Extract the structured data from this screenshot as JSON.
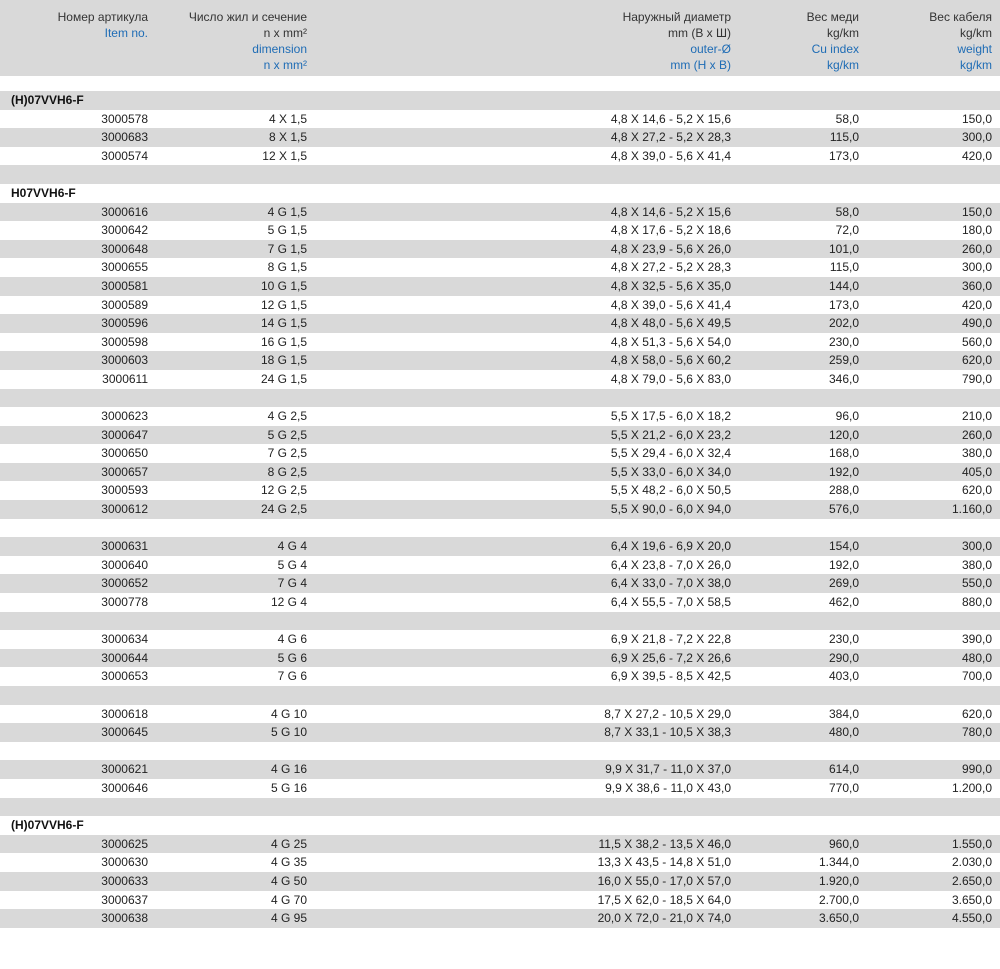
{
  "header": {
    "item": [
      "Номер артикула",
      "Item no."
    ],
    "dimension": [
      "Число жил и сечение",
      "n x mm²",
      "dimension",
      "n x mm²"
    ],
    "outer": [
      "Наружный диаметр",
      "mm (В x Ш)",
      "outer-Ø",
      "mm (H x B)"
    ],
    "cu": [
      "Вес меди",
      "kg/km",
      "Cu index",
      "kg/km"
    ],
    "weight": [
      "Вес кабеля",
      "kg/km",
      "weight",
      "kg/km"
    ]
  },
  "rows": [
    {
      "t": "title",
      "label": "(H)07VVH6-F"
    },
    {
      "t": "data",
      "v": [
        "3000578",
        "4 X 1,5",
        "4,8 X 14,6 - 5,2 X 15,6",
        "58,0",
        "150,0"
      ]
    },
    {
      "t": "data",
      "v": [
        "3000683",
        "8 X 1,5",
        "4,8 X 27,2 - 5,2 X 28,3",
        "115,0",
        "300,0"
      ]
    },
    {
      "t": "data",
      "v": [
        "3000574",
        "12 X 1,5",
        "4,8 X 39,0 - 5,6 X 41,4",
        "173,0",
        "420,0"
      ]
    },
    {
      "t": "blank"
    },
    {
      "t": "title",
      "label": "H07VVH6-F"
    },
    {
      "t": "data",
      "v": [
        "3000616",
        "4 G 1,5",
        "4,8 X 14,6 - 5,2 X 15,6",
        "58,0",
        "150,0"
      ]
    },
    {
      "t": "data",
      "v": [
        "3000642",
        "5 G 1,5",
        "4,8 X 17,6 - 5,2 X 18,6",
        "72,0",
        "180,0"
      ]
    },
    {
      "t": "data",
      "v": [
        "3000648",
        "7 G 1,5",
        "4,8 X 23,9 - 5,6 X 26,0",
        "101,0",
        "260,0"
      ]
    },
    {
      "t": "data",
      "v": [
        "3000655",
        "8 G 1,5",
        "4,8 X 27,2 - 5,2 X 28,3",
        "115,0",
        "300,0"
      ]
    },
    {
      "t": "data",
      "v": [
        "3000581",
        "10 G 1,5",
        "4,8 X 32,5 - 5,6 X 35,0",
        "144,0",
        "360,0"
      ]
    },
    {
      "t": "data",
      "v": [
        "3000589",
        "12 G 1,5",
        "4,8 X 39,0 - 5,6 X 41,4",
        "173,0",
        "420,0"
      ]
    },
    {
      "t": "data",
      "v": [
        "3000596",
        "14 G 1,5",
        "4,8 X 48,0 - 5,6 X 49,5",
        "202,0",
        "490,0"
      ]
    },
    {
      "t": "data",
      "v": [
        "3000598",
        "16 G 1,5",
        "4,8 X 51,3 - 5,6 X 54,0",
        "230,0",
        "560,0"
      ]
    },
    {
      "t": "data",
      "v": [
        "3000603",
        "18 G 1,5",
        "4,8 X 58,0 - 5,6 X 60,2",
        "259,0",
        "620,0"
      ]
    },
    {
      "t": "data",
      "v": [
        "3000611",
        "24 G 1,5",
        "4,8 X 79,0 - 5,6 X 83,0",
        "346,0",
        "790,0"
      ]
    },
    {
      "t": "blank"
    },
    {
      "t": "data",
      "v": [
        "3000623",
        "4 G 2,5",
        "5,5 X 17,5 - 6,0 X 18,2",
        "96,0",
        "210,0"
      ]
    },
    {
      "t": "data",
      "v": [
        "3000647",
        "5 G 2,5",
        "5,5 X 21,2 - 6,0 X 23,2",
        "120,0",
        "260,0"
      ]
    },
    {
      "t": "data",
      "v": [
        "3000650",
        "7 G 2,5",
        "5,5 X 29,4 - 6,0 X 32,4",
        "168,0",
        "380,0"
      ]
    },
    {
      "t": "data",
      "v": [
        "3000657",
        "8 G 2,5",
        "5,5 X 33,0 - 6,0 X 34,0",
        "192,0",
        "405,0"
      ]
    },
    {
      "t": "data",
      "v": [
        "3000593",
        "12 G 2,5",
        "5,5 X 48,2 - 6,0 X 50,5",
        "288,0",
        "620,0"
      ]
    },
    {
      "t": "data",
      "v": [
        "3000612",
        "24 G 2,5",
        "5,5 X 90,0 - 6,0 X 94,0",
        "576,0",
        "1.160,0"
      ]
    },
    {
      "t": "blank"
    },
    {
      "t": "data",
      "v": [
        "3000631",
        "4 G 4",
        "6,4 X 19,6 - 6,9 X 20,0",
        "154,0",
        "300,0"
      ]
    },
    {
      "t": "data",
      "v": [
        "3000640",
        "5 G 4",
        "6,4 X 23,8 - 7,0 X 26,0",
        "192,0",
        "380,0"
      ]
    },
    {
      "t": "data",
      "v": [
        "3000652",
        "7 G 4",
        "6,4 X 33,0 - 7,0 X 38,0",
        "269,0",
        "550,0"
      ]
    },
    {
      "t": "data",
      "v": [
        "3000778",
        "12 G 4",
        "6,4 X 55,5 - 7,0 X 58,5",
        "462,0",
        "880,0"
      ]
    },
    {
      "t": "blank"
    },
    {
      "t": "data",
      "v": [
        "3000634",
        "4 G 6",
        "6,9 X 21,8 - 7,2 X 22,8",
        "230,0",
        "390,0"
      ]
    },
    {
      "t": "data",
      "v": [
        "3000644",
        "5 G 6",
        "6,9 X 25,6 - 7,2 X 26,6",
        "290,0",
        "480,0"
      ]
    },
    {
      "t": "data",
      "v": [
        "3000653",
        "7 G 6",
        "6,9 X 39,5 - 8,5 X 42,5",
        "403,0",
        "700,0"
      ]
    },
    {
      "t": "blank"
    },
    {
      "t": "data",
      "v": [
        "3000618",
        "4 G 10",
        "8,7 X 27,2 - 10,5 X 29,0",
        "384,0",
        "620,0"
      ]
    },
    {
      "t": "data",
      "v": [
        "3000645",
        "5 G 10",
        "8,7 X 33,1 - 10,5 X 38,3",
        "480,0",
        "780,0"
      ]
    },
    {
      "t": "blank"
    },
    {
      "t": "data",
      "v": [
        "3000621",
        "4 G 16",
        "9,9 X 31,7 - 11,0 X 37,0",
        "614,0",
        "990,0"
      ]
    },
    {
      "t": "data",
      "v": [
        "3000646",
        "5 G 16",
        "9,9 X 38,6 - 11,0 X 43,0",
        "770,0",
        "1.200,0"
      ]
    },
    {
      "t": "blank"
    },
    {
      "t": "title",
      "label": "(H)07VVH6-F"
    },
    {
      "t": "data",
      "v": [
        "3000625",
        "4 G 25",
        "11,5 X 38,2 - 13,5 X 46,0",
        "960,0",
        "1.550,0"
      ]
    },
    {
      "t": "data",
      "v": [
        "3000630",
        "4 G 35",
        "13,3 X 43,5 - 14,8 X 51,0",
        "1.344,0",
        "2.030,0"
      ]
    },
    {
      "t": "data",
      "v": [
        "3000633",
        "4 G 50",
        "16,0 X 55,0 - 17,0 X 57,0",
        "1.920,0",
        "2.650,0"
      ]
    },
    {
      "t": "data",
      "v": [
        "3000637",
        "4 G 70",
        "17,5 X 62,0 - 18,5 X 64,0",
        "2.700,0",
        "3.650,0"
      ]
    },
    {
      "t": "data",
      "v": [
        "3000638",
        "4 G 95",
        "20,0 X 72,0 - 21,0 X 74,0",
        "3.650,0",
        "4.550,0"
      ]
    }
  ]
}
